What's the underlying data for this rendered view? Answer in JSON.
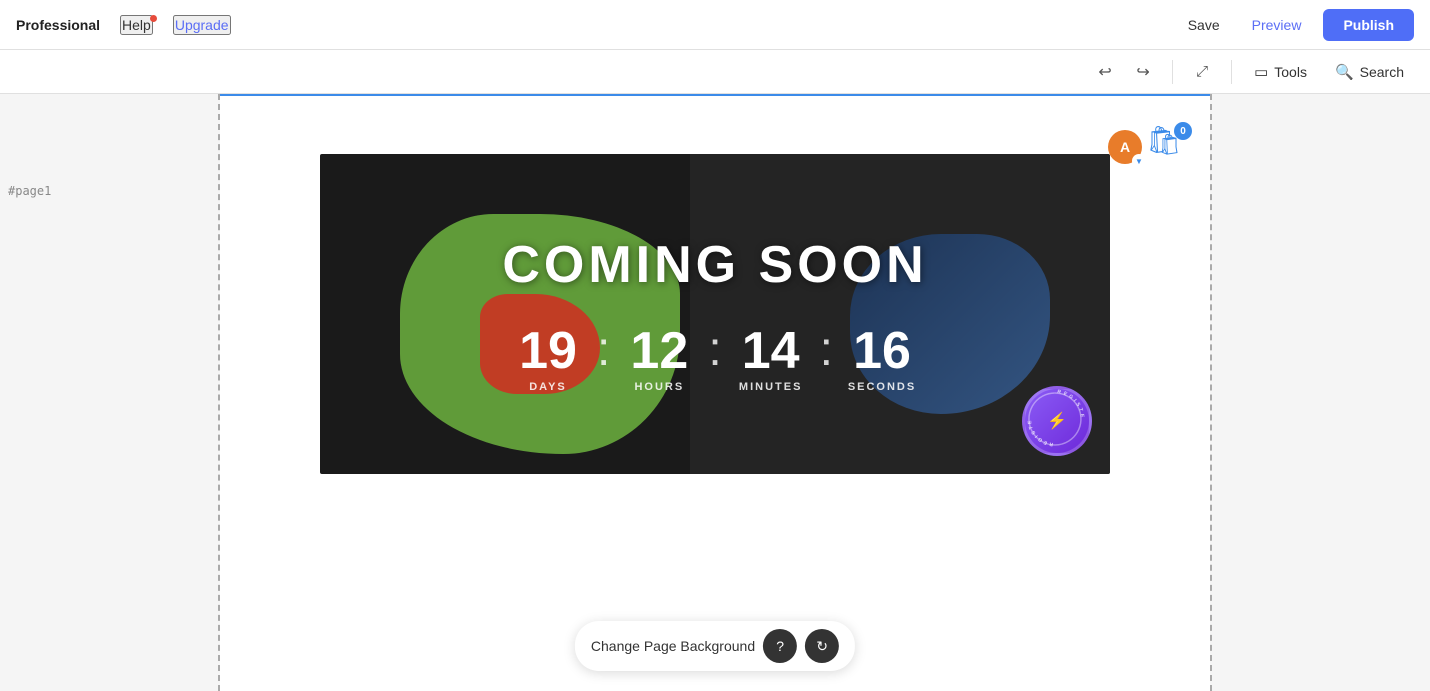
{
  "header": {
    "brand": "Professional",
    "help_label": "Help",
    "upgrade_label": "Upgrade",
    "save_label": "Save",
    "preview_label": "Preview",
    "publish_label": "Publish"
  },
  "toolbar": {
    "undo_icon": "↩",
    "redo_icon": "↪",
    "fit_icon": "⤢",
    "tools_label": "Tools",
    "search_label": "Search"
  },
  "canvas": {
    "page_label": "#page1",
    "banner": {
      "title": "COMING SOON",
      "countdown": {
        "days_value": "19",
        "days_label": "DAYS",
        "hours_value": "12",
        "hours_label": "HOURS",
        "minutes_value": "14",
        "minutes_label": "MINUTES",
        "seconds_value": "16",
        "seconds_label": "SECONDS",
        "sep": ":"
      },
      "badge_text": "REGISTER NOW"
    },
    "cart_count": "0",
    "avatar_letter": "A"
  },
  "floating_toolbar": {
    "change_bg_label": "Change Page Background",
    "help_icon": "?",
    "refresh_icon": "↻"
  }
}
